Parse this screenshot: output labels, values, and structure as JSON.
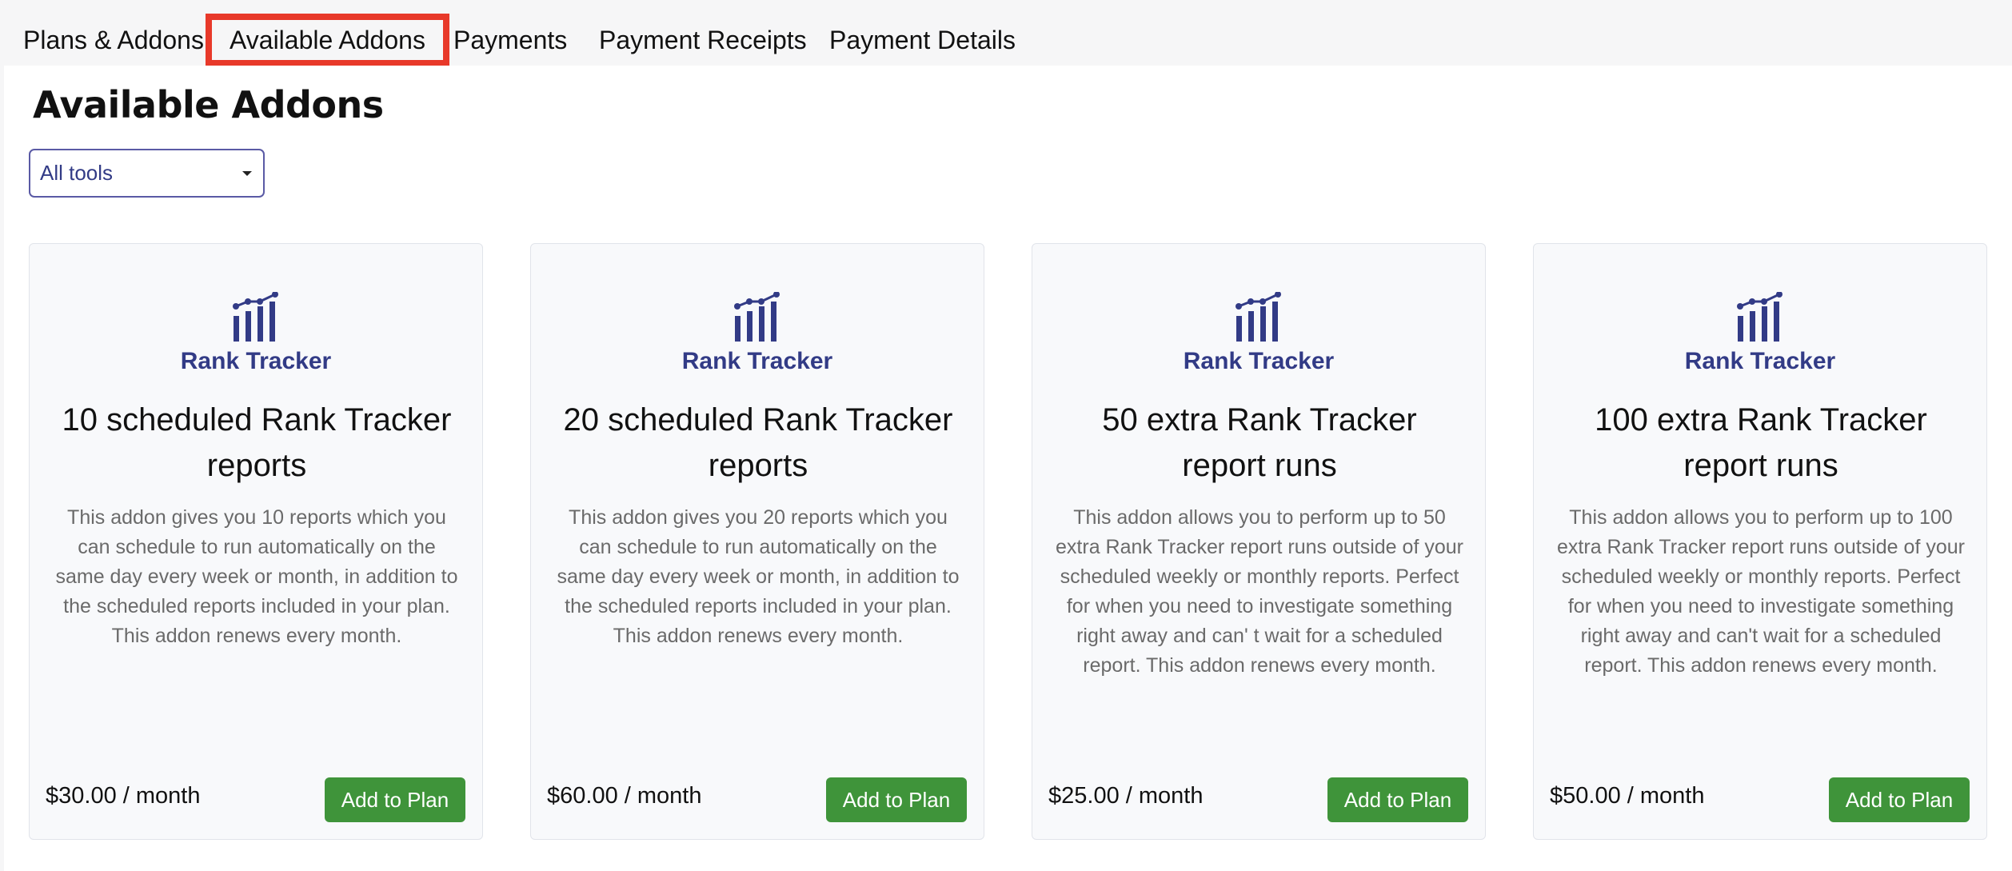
{
  "tabs": [
    {
      "label": "Plans & Addons"
    },
    {
      "label": "Available Addons",
      "active": true
    },
    {
      "label": "Payments"
    },
    {
      "label": "Payment Receipts"
    },
    {
      "label": "Payment Details"
    }
  ],
  "page": {
    "title": "Available Addons"
  },
  "filter": {
    "selected": "All tools"
  },
  "accent_colors": {
    "active_tab_border": "#e8392a",
    "brand_text": "#323b86",
    "button": "#3f943a"
  },
  "addons": [
    {
      "tool": "Rank Tracker",
      "icon": "chart-icon",
      "title": "10 scheduled Rank Tracker reports",
      "description": "This addon gives you 10 reports which you can schedule to run automatically on the same day every week or month, in addition to the scheduled reports included in your plan. This addon renews every month.",
      "price": "$30.00 / month",
      "button": "Add to Plan"
    },
    {
      "tool": "Rank Tracker",
      "icon": "chart-icon",
      "title": "20 scheduled Rank Tracker reports",
      "description": "This addon gives you 20 reports which you can schedule to run automatically on the same day every week or month, in addition to the scheduled reports included in your plan. This addon renews every month.",
      "price": "$60.00 / month",
      "button": "Add to Plan"
    },
    {
      "tool": "Rank Tracker",
      "icon": "chart-icon",
      "title": "50 extra Rank Tracker report runs",
      "description": "This addon allows you to perform up to 50 extra Rank Tracker report runs outside of your scheduled weekly or monthly reports. Perfect for when you need to investigate something right away and can' t wait for a scheduled report. This addon renews every month.",
      "price": "$25.00 / month",
      "button": "Add to Plan"
    },
    {
      "tool": "Rank Tracker",
      "icon": "chart-icon",
      "title": "100 extra Rank Tracker report runs",
      "description": "This addon allows you to perform up to 100 extra Rank Tracker report runs outside of your scheduled weekly or monthly reports. Perfect for when you need to investigate something right away and can't wait for a scheduled report. This addon renews every month.",
      "price": "$50.00 / month",
      "button": "Add to Plan"
    }
  ]
}
